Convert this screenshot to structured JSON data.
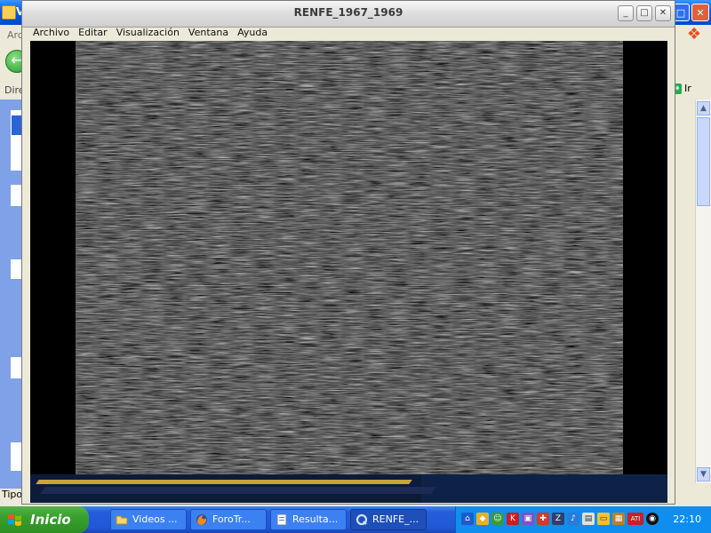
{
  "background_window": {
    "title_fragment": "V",
    "menu_fragment": "Arc",
    "address_fragment": "Dire",
    "go_label": "Ir",
    "status_fragment": "Tipo:"
  },
  "player": {
    "title": "RENFE_1967_1969",
    "menu": [
      "Archivo",
      "Editar",
      "Visualización",
      "Ventana",
      "Ayuda"
    ]
  },
  "taskbar": {
    "start_label": "Inicio",
    "buttons": [
      {
        "label": "Videos ...",
        "icon": "folder-icon"
      },
      {
        "label": "ForoTr...",
        "icon": "firefox-icon"
      },
      {
        "label": "Resulta...",
        "icon": "document-icon"
      },
      {
        "label": "RENFE_...",
        "icon": "quicktime-icon",
        "active": true
      }
    ],
    "tray_icons": [
      "network-icon",
      "security-shield-icon",
      "messenger-icon",
      "antivirus-icon",
      "firewall-icon",
      "update-icon",
      "zip-icon",
      "speaker-icon",
      "display-icon",
      "monitor-icon",
      "notes-icon",
      "ati-icon",
      "media-icon"
    ],
    "tray_ati": "ATI",
    "clock": "22:10"
  },
  "colors": {
    "taskbar_blue": "#245edb",
    "start_green": "#37a02c",
    "tray_blue": "#0f8ef0"
  }
}
